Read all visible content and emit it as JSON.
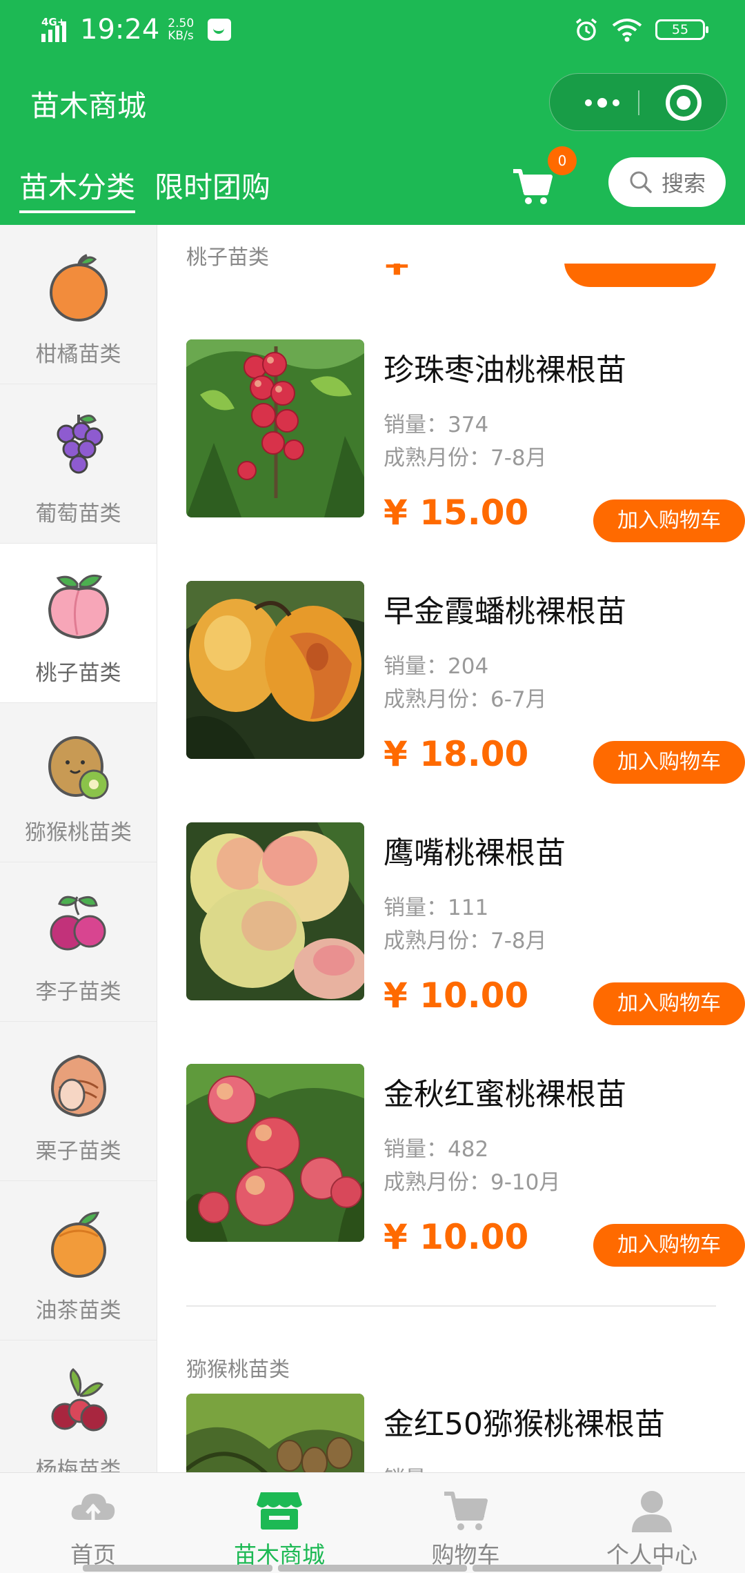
{
  "status_bar": {
    "network": "4G+",
    "time": "19:24",
    "speed": "2.50",
    "speed_unit": "KB/s",
    "battery": "55",
    "icons": [
      "signal-icon",
      "message-icon",
      "alarm-icon",
      "wifi-icon",
      "battery-icon"
    ]
  },
  "header": {
    "title": "苗木商城",
    "tabs": [
      {
        "label": "苗木分类",
        "active": true
      },
      {
        "label": "限时团购",
        "active": false
      }
    ],
    "cart_count": "0",
    "search_label": "搜索"
  },
  "sidebar": {
    "items": [
      {
        "label": "柑橘苗类",
        "icon": "orange-icon"
      },
      {
        "label": "葡萄苗类",
        "icon": "grape-icon"
      },
      {
        "label": "桃子苗类",
        "icon": "peach-icon",
        "active": true
      },
      {
        "label": "猕猴桃苗类",
        "icon": "kiwi-icon"
      },
      {
        "label": "李子苗类",
        "icon": "plum-icon"
      },
      {
        "label": "栗子苗类",
        "icon": "chestnut-icon"
      },
      {
        "label": "油茶苗类",
        "icon": "camellia-fruit-icon"
      },
      {
        "label": "杨梅苗类",
        "icon": "bayberry-icon"
      }
    ]
  },
  "main": {
    "section_peach": "桃子苗类",
    "section_kiwi": "猕猴桃苗类",
    "sales_label": "销量：",
    "mature_label": "成熟月份：",
    "add_to_cart": "加入购物车",
    "products": [
      {
        "name": "珍珠枣油桃裸根苗",
        "sales": "374",
        "mature": "7-8月",
        "price": "¥ 15.00"
      },
      {
        "name": "早金霞蟠桃裸根苗",
        "sales": "204",
        "mature": "6-7月",
        "price": "¥ 18.00"
      },
      {
        "name": "鹰嘴桃裸根苗",
        "sales": "111",
        "mature": "7-8月",
        "price": "¥ 10.00"
      },
      {
        "name": "金秋红蜜桃裸根苗",
        "sales": "482",
        "mature": "9-10月",
        "price": "¥ 10.00"
      }
    ],
    "next_product": {
      "name": "金红50猕猴桃裸根苗"
    }
  },
  "tabbar": {
    "items": [
      {
        "label": "首页",
        "icon": "home-icon",
        "active": false
      },
      {
        "label": "苗木商城",
        "icon": "shop-icon",
        "active": true
      },
      {
        "label": "购物车",
        "icon": "cart-icon",
        "active": false
      },
      {
        "label": "个人中心",
        "icon": "user-icon",
        "active": false
      }
    ]
  },
  "colors": {
    "brand_green": "#1db954",
    "accent_orange": "#ff6a00"
  }
}
